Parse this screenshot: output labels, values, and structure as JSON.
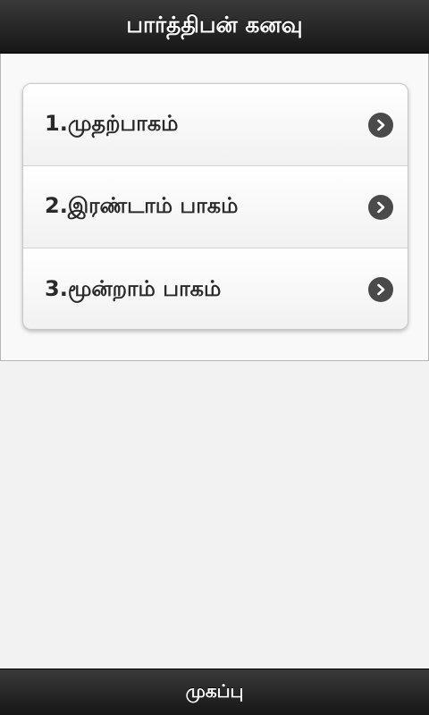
{
  "header": {
    "title": "பார்த்திபன் கனவு"
  },
  "list": {
    "items": [
      {
        "label": "1.முதற்பாகம்",
        "icon": "chevron-right-icon"
      },
      {
        "label": "2.இரண்டாம் பாகம்",
        "icon": "chevron-right-icon"
      },
      {
        "label": "3.மூன்றாம் பாகம்",
        "icon": "chevron-right-icon"
      }
    ]
  },
  "footer": {
    "home_label": "முகப்பு"
  },
  "colors": {
    "bar_top": "#3a3a3a",
    "bar_bottom": "#161616",
    "chevron_bg": "#4a4a4a",
    "page_bg": "#f2f2f2"
  }
}
